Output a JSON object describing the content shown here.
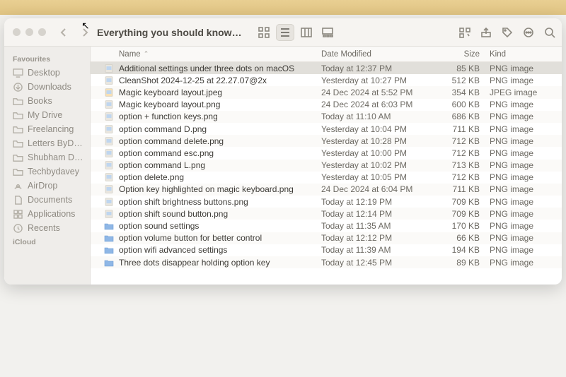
{
  "menubar": {
    "apple_glyph": ""
  },
  "window": {
    "title": "Everything you should know…",
    "traffic": [
      "close",
      "minimize",
      "zoom"
    ],
    "nav": {
      "back": "‹",
      "forward": "›"
    },
    "toolbar": {
      "view_icons": "icon-view",
      "view_list": "list-view",
      "view_columns": "column-view",
      "view_gallery": "gallery-view",
      "group": "group-menu",
      "share": "share",
      "tag": "tag",
      "more": "more-menu",
      "search": "search"
    }
  },
  "sidebar": {
    "sections": [
      {
        "title": "Favourites",
        "items": [
          {
            "label": "Desktop",
            "icon": "desktop"
          },
          {
            "label": "Downloads",
            "icon": "downloads"
          },
          {
            "label": "Books",
            "icon": "folder"
          },
          {
            "label": "My Drive",
            "icon": "folder"
          },
          {
            "label": "Freelancing",
            "icon": "folder"
          },
          {
            "label": "Letters ByD…",
            "icon": "folder"
          },
          {
            "label": "Shubham D…",
            "icon": "folder"
          },
          {
            "label": "Techbydavey",
            "icon": "folder"
          },
          {
            "label": "AirDrop",
            "icon": "airdrop"
          },
          {
            "label": "Documents",
            "icon": "doc"
          },
          {
            "label": "Applications",
            "icon": "apps"
          },
          {
            "label": "Recents",
            "icon": "clock"
          }
        ]
      },
      {
        "title": "iCloud",
        "items": []
      }
    ]
  },
  "columns": {
    "name": "Name",
    "date": "Date Modified",
    "size": "Size",
    "kind": "Kind"
  },
  "rows": [
    {
      "sel": true,
      "icon": "png",
      "name": "Additional settings under three dots on macOS",
      "date": "Today at 12:37 PM",
      "size": "85 KB",
      "kind": "PNG image"
    },
    {
      "sel": false,
      "icon": "png",
      "name": "CleanShot 2024-12-25 at 22.27.07@2x",
      "date": "Yesterday at 10:27 PM",
      "size": "512 KB",
      "kind": "PNG image"
    },
    {
      "sel": false,
      "icon": "jpeg",
      "name": "Magic keyboard layout.jpeg",
      "date": "24 Dec 2024 at 5:52 PM",
      "size": "354 KB",
      "kind": "JPEG image"
    },
    {
      "sel": false,
      "icon": "png",
      "name": "Magic keyboard layout.png",
      "date": "24 Dec 2024 at 6:03 PM",
      "size": "600 KB",
      "kind": "PNG image"
    },
    {
      "sel": false,
      "icon": "png",
      "name": "option + function keys.png",
      "date": "Today at 11:10 AM",
      "size": "686 KB",
      "kind": "PNG image"
    },
    {
      "sel": false,
      "icon": "png",
      "name": "option command D.png",
      "date": "Yesterday at 10:04 PM",
      "size": "711 KB",
      "kind": "PNG image"
    },
    {
      "sel": false,
      "icon": "png",
      "name": "option command delete.png",
      "date": "Yesterday at 10:28 PM",
      "size": "712 KB",
      "kind": "PNG image"
    },
    {
      "sel": false,
      "icon": "png",
      "name": "option command esc.png",
      "date": "Yesterday at 10:00 PM",
      "size": "712 KB",
      "kind": "PNG image"
    },
    {
      "sel": false,
      "icon": "png",
      "name": "option command L.png",
      "date": "Yesterday at 10:02 PM",
      "size": "713 KB",
      "kind": "PNG image"
    },
    {
      "sel": false,
      "icon": "png",
      "name": "option delete.png",
      "date": "Yesterday at 10:05 PM",
      "size": "712 KB",
      "kind": "PNG image"
    },
    {
      "sel": false,
      "icon": "png",
      "name": "Option key highlighted on magic keyboard.png",
      "date": "24 Dec 2024 at 6:04 PM",
      "size": "711 KB",
      "kind": "PNG image"
    },
    {
      "sel": false,
      "icon": "png",
      "name": "option shift brightness buttons.png",
      "date": "Today at 12:19 PM",
      "size": "709 KB",
      "kind": "PNG image"
    },
    {
      "sel": false,
      "icon": "png",
      "name": "option shift sound button.png",
      "date": "Today at 12:14 PM",
      "size": "709 KB",
      "kind": "PNG image"
    },
    {
      "sel": false,
      "icon": "folder",
      "name": "option sound settings",
      "date": "Today at 11:35 AM",
      "size": "170 KB",
      "kind": "PNG image"
    },
    {
      "sel": false,
      "icon": "folder",
      "name": "option volume button for better control",
      "date": "Today at 12:12 PM",
      "size": "66 KB",
      "kind": "PNG image"
    },
    {
      "sel": false,
      "icon": "folder",
      "name": "option wifi advanced settings",
      "date": "Today at 11:39 AM",
      "size": "194 KB",
      "kind": "PNG image"
    },
    {
      "sel": false,
      "icon": "folder",
      "name": "Three dots disappear holding option key",
      "date": "Today at 12:45 PM",
      "size": "89 KB",
      "kind": "PNG image"
    }
  ]
}
